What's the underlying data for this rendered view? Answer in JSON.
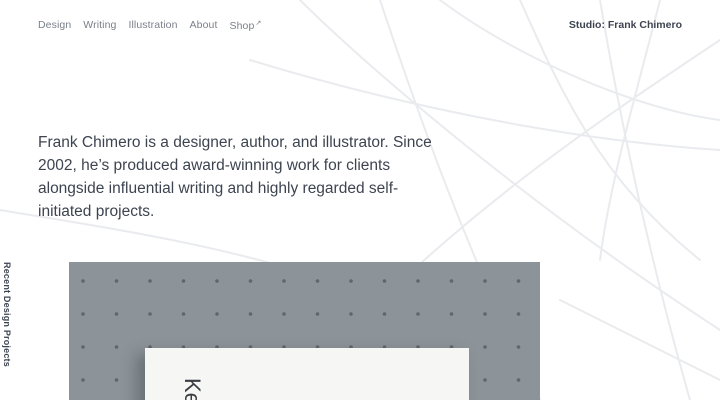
{
  "nav": {
    "items": [
      {
        "label": "Design"
      },
      {
        "label": "Writing"
      },
      {
        "label": "Illustration"
      },
      {
        "label": "About"
      },
      {
        "label": "Shop",
        "external_marker": "↗"
      }
    ]
  },
  "studio_link": "Studio: Frank Chimero",
  "intro": "Frank Chimero is a designer, author, and illustrator. Since 2002, he’s produced award-winning work for clients alongside influential writing and highly regarded self-initiated projects.",
  "side_label": "Recent Design Projects",
  "project": {
    "card_text": "Ke"
  },
  "colors": {
    "text": "#3d4450",
    "nav_text": "#7a808a",
    "image_bg": "#8c9399",
    "card": "#f6f6f4"
  }
}
